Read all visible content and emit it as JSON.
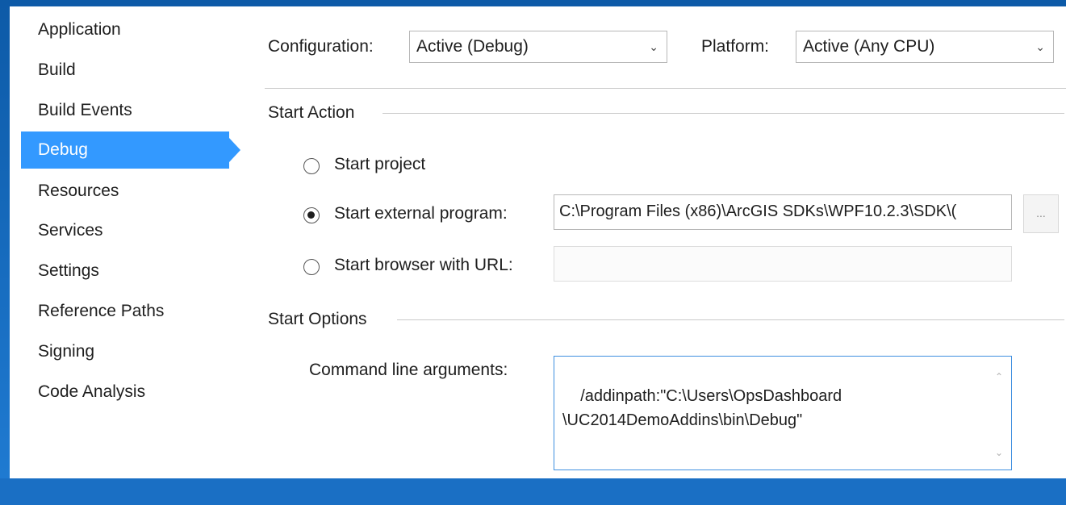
{
  "sidebar": {
    "items": [
      {
        "label": "Application"
      },
      {
        "label": "Build"
      },
      {
        "label": "Build Events"
      },
      {
        "label": "Debug"
      },
      {
        "label": "Resources"
      },
      {
        "label": "Services"
      },
      {
        "label": "Settings"
      },
      {
        "label": "Reference Paths"
      },
      {
        "label": "Signing"
      },
      {
        "label": "Code Analysis"
      }
    ],
    "active": "Debug"
  },
  "toolbar": {
    "configuration_label": "Configuration:",
    "configuration_value": "Active (Debug)",
    "platform_label": "Platform:",
    "platform_value": "Active (Any CPU)"
  },
  "start_action": {
    "title": "Start Action",
    "start_project": "Start project",
    "start_external": "Start external program:",
    "external_program_path": "C:\\Program Files (x86)\\ArcGIS SDKs\\WPF10.2.3\\SDK\\(",
    "browse_label": "...",
    "start_browser": "Start browser with URL:",
    "browser_url": "",
    "selected": "Start external program:"
  },
  "start_options": {
    "title": "Start Options",
    "cmd_label": "Command line arguments:",
    "cmd_value": "/addinpath:\"C:\\Users\\OpsDashboard\n\\UC2014DemoAddins\\bin\\Debug\""
  },
  "icons": {
    "dropdown": "chevron-down-icon",
    "scroll_up": "scroll-up-icon",
    "scroll_down": "scroll-down-icon"
  },
  "colors": {
    "accent": "#3399ff",
    "frame": "#1a6fc4"
  }
}
